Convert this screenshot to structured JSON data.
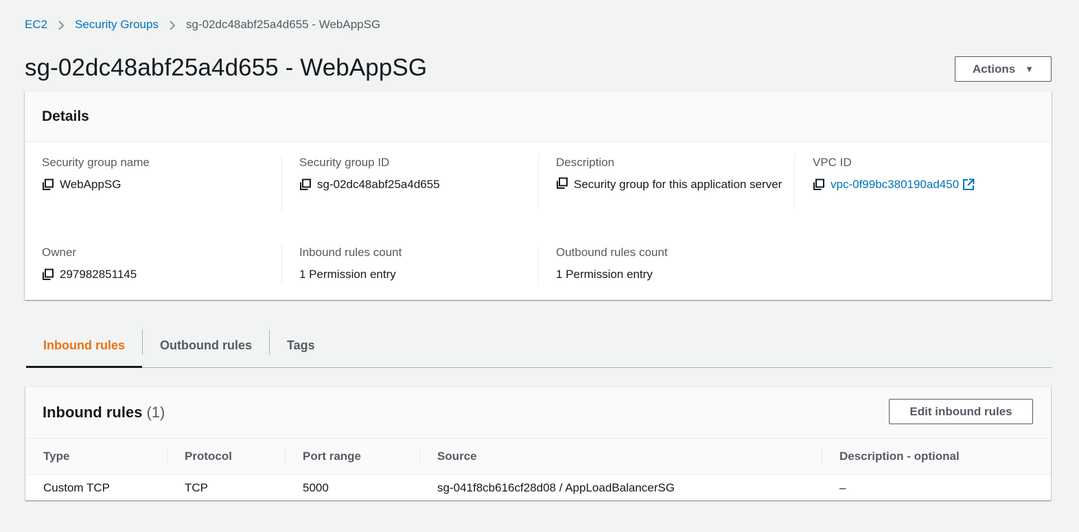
{
  "breadcrumb": {
    "items": [
      "EC2",
      "Security Groups"
    ],
    "current": "sg-02dc48abf25a4d655 - WebAppSG"
  },
  "page": {
    "title": "sg-02dc48abf25a4d655 - WebAppSG",
    "actions_label": "Actions"
  },
  "details": {
    "title": "Details",
    "fields": {
      "sg_name": {
        "label": "Security group name",
        "value": "WebAppSG"
      },
      "sg_id": {
        "label": "Security group ID",
        "value": "sg-02dc48abf25a4d655"
      },
      "description": {
        "label": "Description",
        "value": "Security group for this application server"
      },
      "vpc_id": {
        "label": "VPC ID",
        "value": "vpc-0f99bc380190ad450"
      },
      "owner": {
        "label": "Owner",
        "value": "297982851145"
      },
      "inbound_count": {
        "label": "Inbound rules count",
        "value": "1 Permission entry"
      },
      "outbound_count": {
        "label": "Outbound rules count",
        "value": "1 Permission entry"
      }
    }
  },
  "tabs": [
    {
      "label": "Inbound rules",
      "active": true
    },
    {
      "label": "Outbound rules",
      "active": false
    },
    {
      "label": "Tags",
      "active": false
    }
  ],
  "inbound": {
    "title": "Inbound rules",
    "count": "(1)",
    "edit_label": "Edit inbound rules",
    "columns": [
      "Type",
      "Protocol",
      "Port range",
      "Source",
      "Description - optional"
    ],
    "rows": [
      [
        "Custom TCP",
        "TCP",
        "5000",
        "sg-041f8cb616cf28d08 / AppLoadBalancerSG",
        "–"
      ]
    ]
  },
  "colors": {
    "link": "#0073bb",
    "active_tab": "#ec7211",
    "page_bg": "#f2f3f3"
  },
  "icons": [
    "chevron-right-icon",
    "caret-down-icon",
    "copy-icon",
    "external-link-icon"
  ]
}
